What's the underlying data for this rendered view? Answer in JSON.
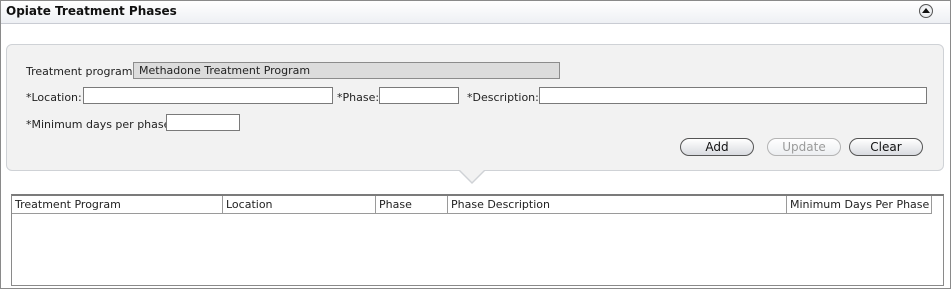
{
  "panel": {
    "title": "Opiate Treatment Phases",
    "collapse_icon": "chevron-up-icon"
  },
  "form": {
    "treatment_program": {
      "label": "Treatment program:",
      "value": "Methadone Treatment Program"
    },
    "location": {
      "label": "*Location:",
      "value": ""
    },
    "phase": {
      "label": "*Phase:",
      "value": ""
    },
    "description": {
      "label": "*Description:",
      "value": ""
    },
    "min_days": {
      "label": "*Minimum days per phase:",
      "value": ""
    }
  },
  "buttons": {
    "add": "Add",
    "update": "Update",
    "clear": "Clear"
  },
  "table": {
    "columns": [
      "Treatment Program",
      "Location",
      "Phase",
      "Phase Description",
      "Minimum Days Per Phase"
    ],
    "rows": []
  }
}
